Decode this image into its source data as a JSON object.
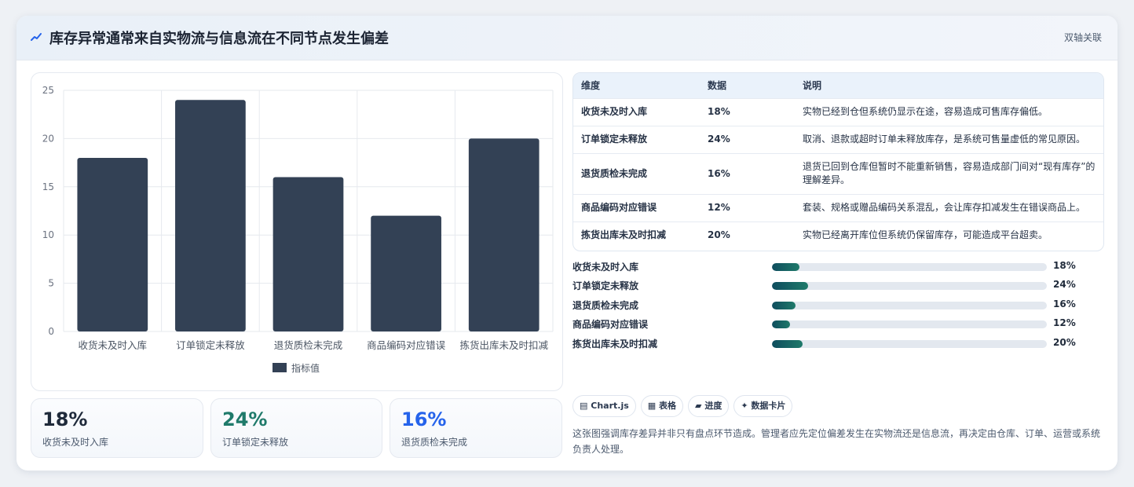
{
  "header": {
    "title": "库存异常通常来自实物流与信息流在不同节点发生偏差",
    "tag": "双轴关联"
  },
  "colors": {
    "bar": "#334155",
    "accent_teal": "#1f7a6a",
    "accent_blue": "#2563eb",
    "dark": "#1f2a3a"
  },
  "chart_data": {
    "type": "bar",
    "categories": [
      "收货未及时入库",
      "订单锁定未释放",
      "退货质检未完成",
      "商品编码对应错误",
      "拣货出库未及时扣减"
    ],
    "series": [
      {
        "name": "指标值",
        "values": [
          18,
          24,
          16,
          12,
          20
        ]
      }
    ],
    "ylim": [
      0,
      25
    ],
    "yticks": [
      "0",
      "5",
      "10",
      "15",
      "20",
      "25"
    ],
    "grid": true,
    "legend": "bottom"
  },
  "stats": [
    {
      "value": "18%",
      "label": "收货未及时入库"
    },
    {
      "value": "24%",
      "label": "订单锁定未释放"
    },
    {
      "value": "16%",
      "label": "退货质检未完成"
    }
  ],
  "table": {
    "headers": [
      "维度",
      "数据",
      "说明"
    ],
    "rows": [
      {
        "dim": "收货未及时入库",
        "val": "18%",
        "desc": "实物已经到仓但系统仍显示在途，容易造成可售库存偏低。"
      },
      {
        "dim": "订单锁定未释放",
        "val": "24%",
        "desc": "取消、退款或超时订单未释放库存，是系统可售量虚低的常见原因。"
      },
      {
        "dim": "退货质检未完成",
        "val": "16%",
        "desc": "退货已回到仓库但暂时不能重新销售，容易造成部门间对“现有库存”的理解差异。"
      },
      {
        "dim": "商品编码对应错误",
        "val": "12%",
        "desc": "套装、规格或赠品编码关系混乱，会让库存扣减发生在错误商品上。"
      },
      {
        "dim": "拣货出库未及时扣减",
        "val": "20%",
        "desc": "实物已经离开库位但系统仍保留库存，可能造成平台超卖。"
      }
    ]
  },
  "progress": [
    {
      "label": "收货未及时入库",
      "value": "18%",
      "fraction": 0.1
    },
    {
      "label": "订单锁定未释放",
      "value": "24%",
      "fraction": 0.13
    },
    {
      "label": "退货质检未完成",
      "value": "16%",
      "fraction": 0.087
    },
    {
      "label": "商品编码对应错误",
      "value": "12%",
      "fraction": 0.065
    },
    {
      "label": "拣货出库未及时扣减",
      "value": "20%",
      "fraction": 0.11
    }
  ],
  "chips": [
    {
      "icon": "chart-icon",
      "glyph": "▤",
      "label": "Chart.js"
    },
    {
      "icon": "table-icon",
      "glyph": "▦",
      "label": "表格"
    },
    {
      "icon": "progress-icon",
      "glyph": "▰",
      "label": "进度"
    },
    {
      "icon": "card-icon",
      "glyph": "✦",
      "label": "数据卡片"
    }
  ],
  "note": "这张图强调库存差异并非只有盘点环节造成。管理者应先定位偏差发生在实物流还是信息流，再决定由仓库、订单、运营或系统负责人处理。"
}
